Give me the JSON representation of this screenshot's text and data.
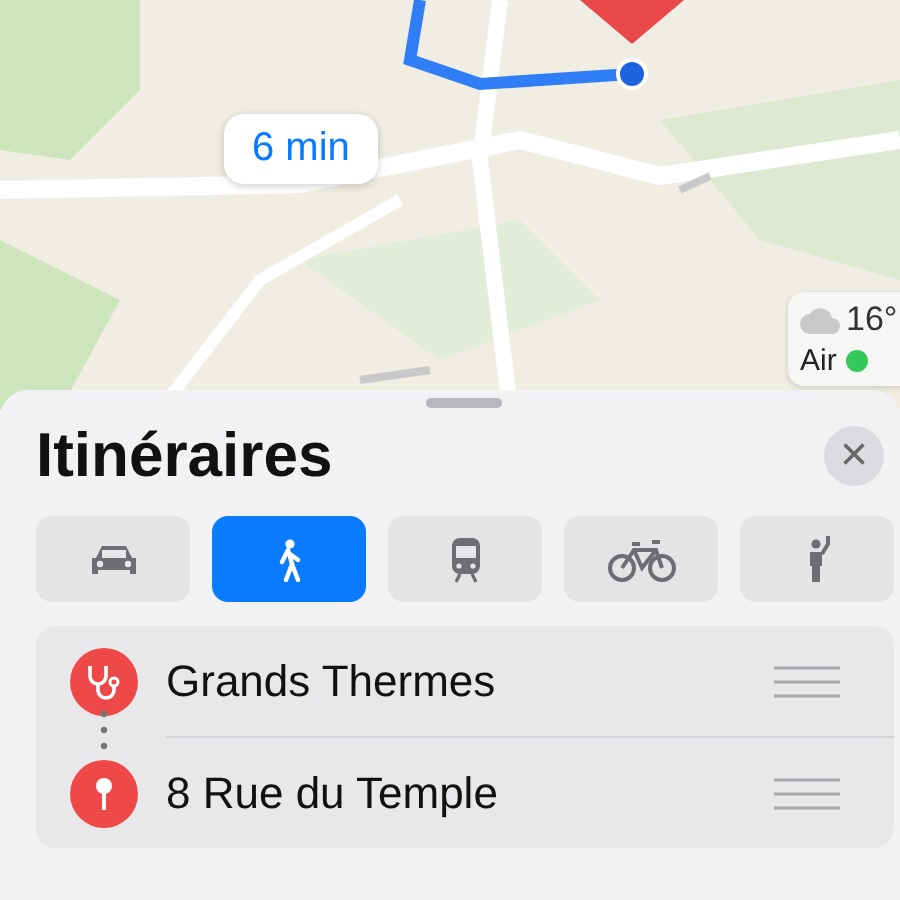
{
  "map": {
    "eta_bubble": "6 min",
    "weather": {
      "temperature": "16°",
      "air_quality": {
        "label": "Air",
        "color": "#34c759"
      }
    }
  },
  "sheet": {
    "title": "Itinéraires",
    "close": "×"
  },
  "modes": [
    {
      "kind": "car",
      "selected": false
    },
    {
      "kind": "walk",
      "selected": true
    },
    {
      "kind": "transit",
      "selected": false
    },
    {
      "kind": "bike",
      "selected": false
    },
    {
      "kind": "rideshare",
      "selected": false
    }
  ],
  "waypoints": [
    {
      "kind": "start",
      "name": "Grands Thermes"
    },
    {
      "kind": "end",
      "name": "8 Rue du Temple"
    }
  ]
}
